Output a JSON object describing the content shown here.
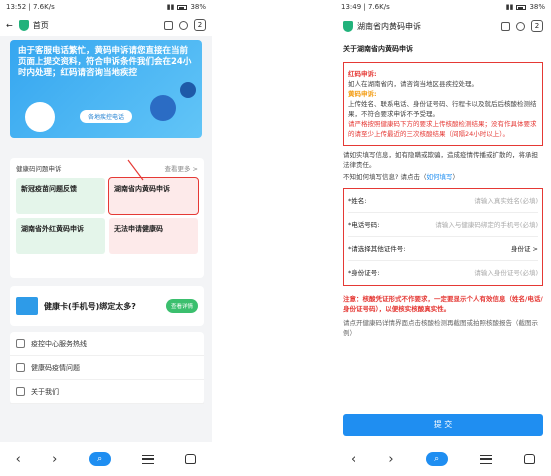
{
  "left": {
    "status": {
      "time": "13:52",
      "speed": "7.6K/s",
      "battery": "38%"
    },
    "nav": {
      "title": "首页",
      "tabs": "2"
    },
    "banner": {
      "text": "由于客服电话繁忙，黄码申诉请您直接在当前页面上提交资料，符合申诉条件我们会在24小时内处理；红码请咨询当地疾控",
      "button": "各地疾控电话"
    },
    "section": {
      "title": "健康码问题申诉",
      "more": "查看更多 >"
    },
    "cells": [
      "新冠疫苗问题反馈",
      "湖南省内黄码申诉",
      "湖南省外红黄码申诉",
      "无法申请健康码"
    ],
    "promo": {
      "label": "健康卡(手机号)绑定太多?",
      "button": "查看详情"
    },
    "list": [
      "疫控中心服务热线",
      "健康码疫情问题",
      "关于我们"
    ]
  },
  "right": {
    "status": {
      "time": "13:49",
      "speed": "7.6K/s",
      "battery": "38%"
    },
    "nav": {
      "title": "湖南省内黄码申诉",
      "tabs": "2"
    },
    "heading": "关于湖南省内黄码申诉",
    "red_title": "红码申诉:",
    "red_body": "如人在湖南省内，请咨询当地区县疾控处理。",
    "yellow_title": "黄码申诉:",
    "yellow_body": "上传姓名、联系电话、身份证号码、行程卡以及就后后核酸检测结果，不符合要求申诉不予受理。",
    "yellow_warn": "请严格按照健康码下方的要求上传核酸检测结果；没有作具体要求的请至少上传最近的三次核酸结果（间隔24小时以上）。",
    "note": "请如实填写信息，如有隐瞒或欺骗，造成疫情传播或扩散的，将承担法律责任。",
    "how": "不知如何填写信息? 请点击（",
    "how_link": "如何填写",
    "how_end": "）",
    "form": [
      {
        "label": "*姓名:",
        "placeholder": "请输入真实姓名(必填)"
      },
      {
        "label": "*电话号码:",
        "placeholder": "请输入与健康码绑定的手机号(必填)"
      },
      {
        "label": "*请选择其他证件号:",
        "placeholder": "身份证   >"
      },
      {
        "label": "*身份证号:",
        "placeholder": "请输入身份证号(必填)"
      }
    ],
    "warn": "注意：核酸凭证形式不作要求，一定要显示个人有效信息（姓名/电话/身份证号码），以便核实核酸真实性。",
    "tail": "请点开健康码详情界面点击核酸检测再截图或拍照核酸报告（截图示例）",
    "submit": "提 交"
  }
}
